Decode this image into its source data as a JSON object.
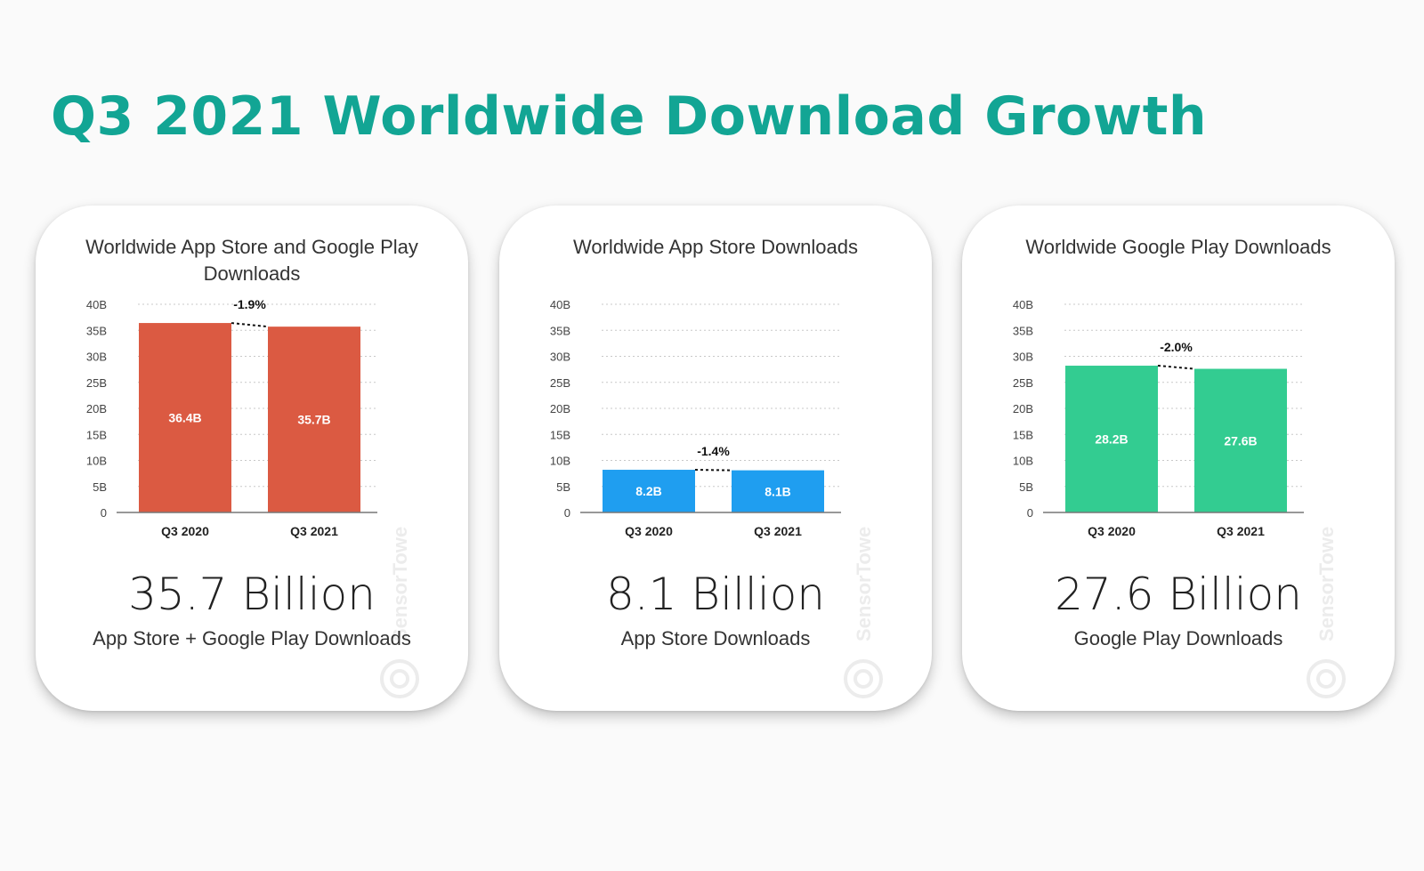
{
  "page": {
    "title": "Q3 2021 Worldwide Download Growth"
  },
  "cards": [
    {
      "title": "Worldwide App Store and Google Play Downloads",
      "big_number": "35.7 Billion",
      "caption": "App Store + Google Play Downloads",
      "watermark": "SensorTower"
    },
    {
      "title": "Worldwide App Store Downloads",
      "big_number": "8.1 Billion",
      "caption": "App Store Downloads",
      "watermark": "SensorTower"
    },
    {
      "title": "Worldwide Google Play Downloads",
      "big_number": "27.6 Billion",
      "caption": "Google Play Downloads",
      "watermark": "SensorTower"
    }
  ],
  "chart_data": [
    {
      "type": "bar",
      "title": "Worldwide App Store and Google Play Downloads",
      "categories": [
        "Q3 2020",
        "Q3 2021"
      ],
      "values": [
        36.4,
        35.7
      ],
      "data_labels": [
        "36.4B",
        "35.7B"
      ],
      "change_label": "-1.9%",
      "y_ticks": [
        "0",
        "5B",
        "10B",
        "15B",
        "20B",
        "25B",
        "30B",
        "35B",
        "40B"
      ],
      "ylim": [
        0,
        40
      ],
      "grid": true,
      "color": "#db5a42"
    },
    {
      "type": "bar",
      "title": "Worldwide App Store Downloads",
      "categories": [
        "Q3 2020",
        "Q3 2021"
      ],
      "values": [
        8.2,
        8.1
      ],
      "data_labels": [
        "8.2B",
        "8.1B"
      ],
      "change_label": "-1.4%",
      "y_ticks": [
        "0",
        "5B",
        "10B",
        "15B",
        "20B",
        "25B",
        "30B",
        "35B",
        "40B"
      ],
      "ylim": [
        0,
        40
      ],
      "grid": true,
      "color": "#1f9ef0"
    },
    {
      "type": "bar",
      "title": "Worldwide Google Play Downloads",
      "categories": [
        "Q3 2020",
        "Q3 2021"
      ],
      "values": [
        28.2,
        27.6
      ],
      "data_labels": [
        "28.2B",
        "27.6B"
      ],
      "change_label": "-2.0%",
      "y_ticks": [
        "0",
        "5B",
        "10B",
        "15B",
        "20B",
        "25B",
        "30B",
        "35B",
        "40B"
      ],
      "ylim": [
        0,
        40
      ],
      "grid": true,
      "color": "#33cc91"
    }
  ]
}
